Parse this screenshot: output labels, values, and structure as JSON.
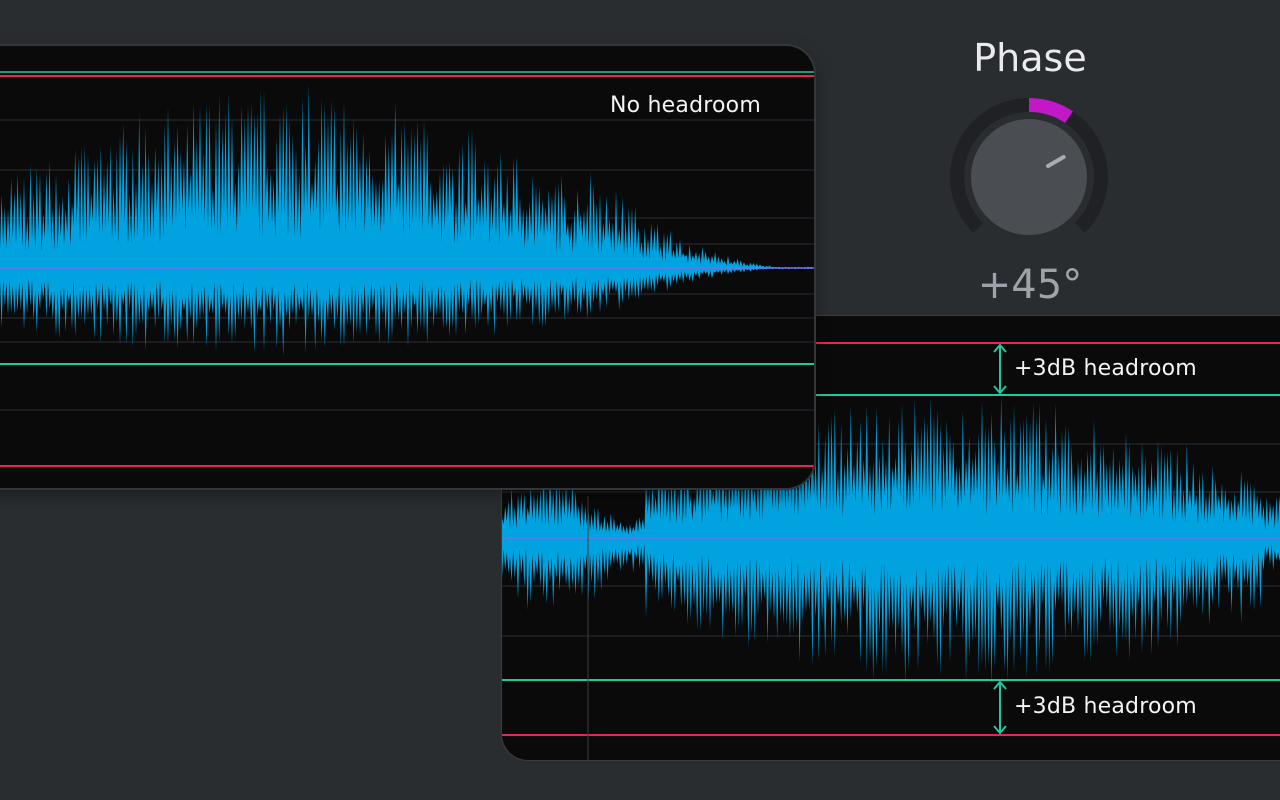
{
  "colors": {
    "background": "#2a2d30",
    "panel": "#0a0a0b",
    "waveform": "#00a3e0",
    "limit_line": "#e8245c",
    "headroom_line": "#22c9a0",
    "center_line": "#7a6cf0",
    "knob_arc": "#c218c8",
    "arrow": "#22c9a0"
  },
  "top_panel": {
    "label": "No headroom"
  },
  "bottom_panel": {
    "headroom_top_label": "+3dB headroom",
    "headroom_bottom_label": "+3dB headroom"
  },
  "phase": {
    "title": "Phase",
    "value_text": "+45°",
    "value_degrees": 45
  },
  "icons": {
    "arrow_top": "double-arrow-vertical-icon",
    "arrow_bottom": "double-arrow-vertical-icon"
  }
}
